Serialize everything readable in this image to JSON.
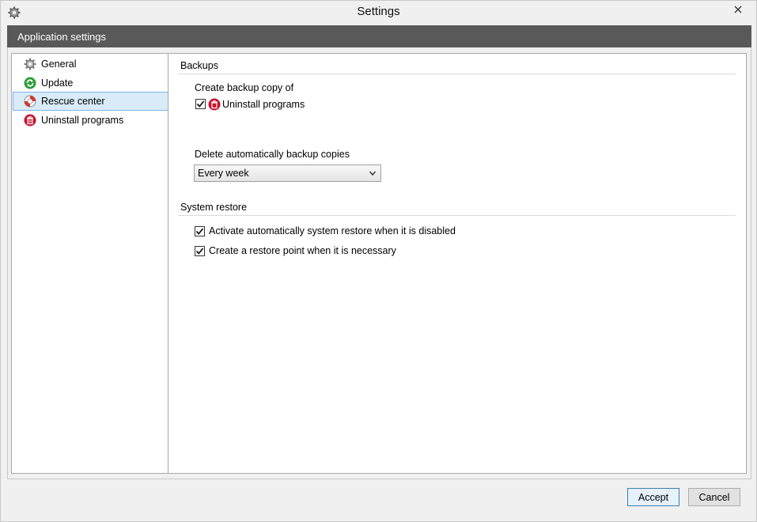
{
  "window": {
    "title": "Settings"
  },
  "banner": {
    "title": "Application settings"
  },
  "sidebar": {
    "items": [
      {
        "label": "General",
        "icon": "gear-icon"
      },
      {
        "label": "Update",
        "icon": "refresh-icon"
      },
      {
        "label": "Rescue center",
        "icon": "lifebuoy-icon",
        "selected": true
      },
      {
        "label": "Uninstall programs",
        "icon": "uninstall-icon"
      }
    ]
  },
  "backups": {
    "title": "Backups",
    "create_label": "Create backup copy of",
    "uninstall_programs_label": "Uninstall programs",
    "uninstall_programs_checked": true,
    "delete_label": "Delete automatically backup copies",
    "delete_select_value": "Every week"
  },
  "system_restore": {
    "title": "System restore",
    "activate_label": "Activate automatically system restore when it is disabled",
    "activate_checked": true,
    "create_point_label": "Create a restore point when it is necessary",
    "create_point_checked": true
  },
  "buttons": {
    "accept": "Accept",
    "cancel": "Cancel"
  },
  "colors": {
    "banner_bg": "#595959",
    "selected_bg": "#d9ebf9",
    "uninstall_red": "#c8102e",
    "update_green": "#2e9e3a"
  }
}
